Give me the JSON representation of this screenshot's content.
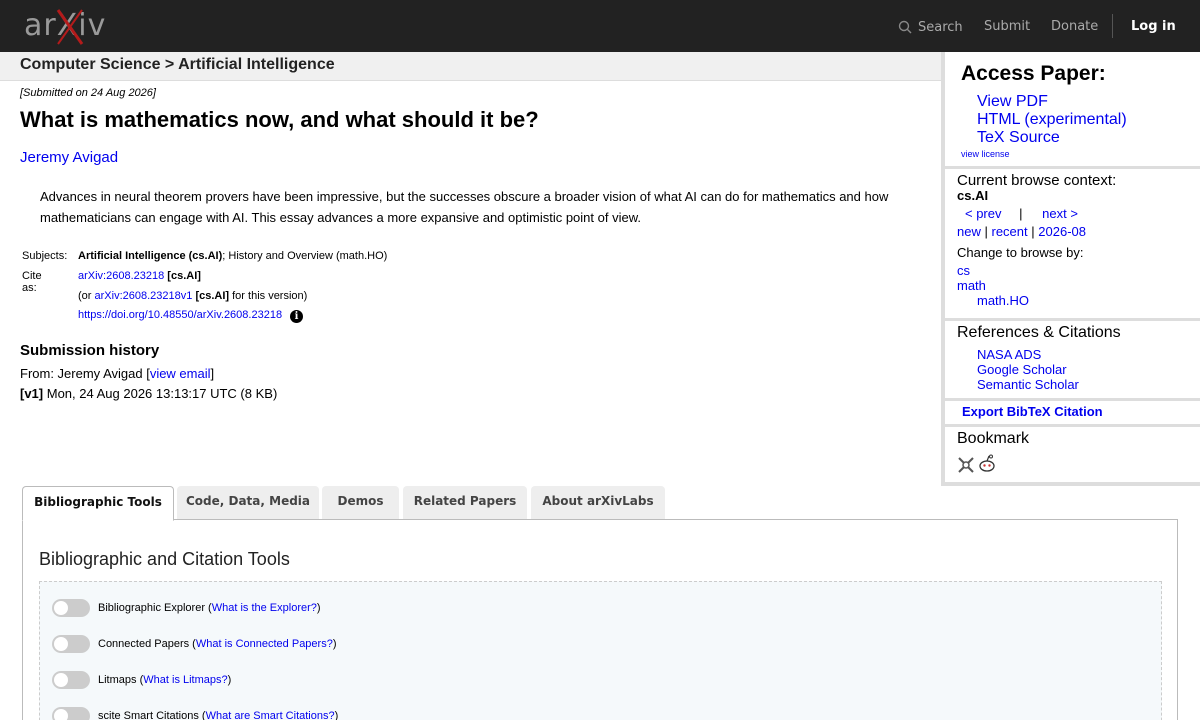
{
  "header": {
    "logo": "arXiv",
    "search_label": "Search",
    "submit_label": "Submit",
    "donate_label": "Donate",
    "login_label": "Log in"
  },
  "breadcrumb": "Computer Science > Artificial Intelligence",
  "paper": {
    "submitted": "[Submitted on 24 Aug 2026]",
    "title": "What is mathematics now, and what should it be?",
    "author": "Jeremy Avigad",
    "abstract": "Advances in neural theorem provers have been impressive, but the successes obscure a broader vision of what AI can do for mathematics and how mathematicians can engage with AI. This essay advances a more expansive and optimistic point of view.",
    "subjects_label": "Subjects:",
    "subjects_primary": "Artificial Intelligence (cs.AI)",
    "subjects_rest": "; History and Overview (math.HO)",
    "cite_label": "Cite as:",
    "cite_id": "arXiv:2608.23218",
    "cite_cat": "[cs.AI]",
    "cite_or_prefix": "(or",
    "cite_version_id": "arXiv:2608.23218v1",
    "cite_version_cat": "[cs.AI]",
    "cite_version_suffix": "for this version)",
    "doi": "https://doi.org/10.48550/arXiv.2608.23218"
  },
  "history": {
    "title": "Submission history",
    "from_prefix": "From: Jeremy Avigad [",
    "view_email": "view email",
    "from_suffix": "]",
    "v1_tag": "[v1]",
    "v1_text": "Mon, 24 Aug 2026 13:13:17 UTC (8 KB)"
  },
  "sidebar": {
    "access_title": "Access Paper:",
    "access_links": [
      "View PDF",
      "HTML (experimental)",
      "TeX Source"
    ],
    "view_license": "view license",
    "browse_title": "Current browse context:",
    "browse_context": "cs.AI",
    "prev": "< prev",
    "sep": "|",
    "next": "next >",
    "new": "new",
    "recent": "recent",
    "month": "2026-08",
    "change_title": "Change to browse by:",
    "change_links": [
      "cs",
      "math",
      "math.HO"
    ],
    "refs_title": "References & Citations",
    "refs_links": [
      "NASA ADS",
      "Google Scholar",
      "Semantic Scholar"
    ],
    "export_bibtex": "Export BibTeX Citation",
    "bookmark_title": "Bookmark"
  },
  "tabs": [
    "Bibliographic Tools",
    "Code, Data, Media",
    "Demos",
    "Related Papers",
    "About arXivLabs"
  ],
  "panel": {
    "title": "Bibliographic and Citation Tools",
    "tools": [
      {
        "name": "Bibliographic Explorer",
        "link": "What is the Explorer?"
      },
      {
        "name": "Connected Papers",
        "link": "What is Connected Papers?"
      },
      {
        "name": "Litmaps",
        "link": "What is Litmaps?"
      },
      {
        "name": "scite Smart Citations",
        "link": "What are Smart Citations?"
      }
    ]
  },
  "colors": {
    "header_bg": "#222222",
    "link": "#0000ee",
    "logo_x": "#b31b1b"
  }
}
